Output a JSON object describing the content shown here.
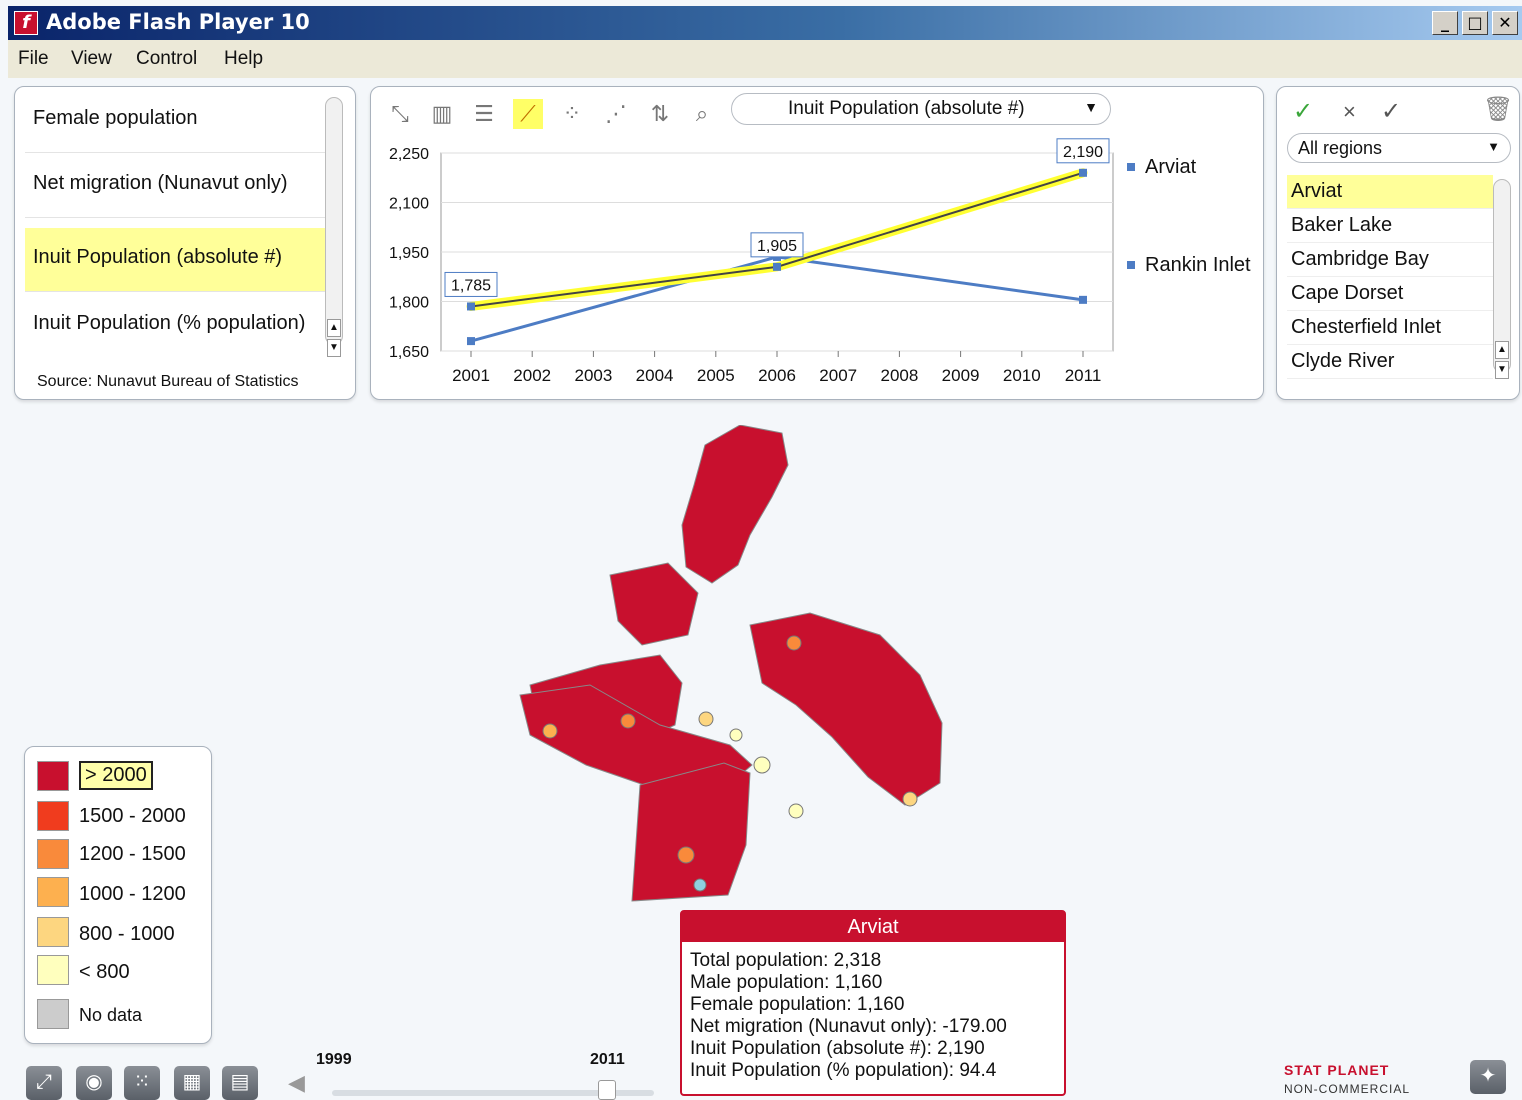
{
  "window": {
    "title": "Adobe Flash Player 10"
  },
  "menu": [
    "File",
    "View",
    "Control",
    "Help"
  ],
  "indicators": {
    "items": [
      "Female population",
      "Net migration (Nunavut only)",
      "Inuit Population (absolute #)",
      "Inuit Population (% population)"
    ],
    "selected_index": 2,
    "source": "Source: Nunavut Bureau of Statistics"
  },
  "chart_panel": {
    "dropdown": "Inuit Population (absolute #)"
  },
  "chart_data": {
    "type": "line",
    "x": [
      2001,
      2002,
      2003,
      2004,
      2005,
      2006,
      2007,
      2008,
      2009,
      2010,
      2011
    ],
    "ylim": [
      1650,
      2250
    ],
    "yticks": [
      2250,
      2100,
      1950,
      1800,
      1650
    ],
    "ytick_labels": [
      "2,250",
      "2,100",
      "1,950",
      "1,800",
      "1,650"
    ],
    "grid": true,
    "legend_position": "right",
    "series": [
      {
        "name": "Arviat",
        "color": "#4d7cc4",
        "highlight": "#ffff33",
        "points": [
          [
            2001,
            1785
          ],
          [
            2006,
            1905
          ],
          [
            2011,
            2190
          ]
        ],
        "labels": [
          "1,785",
          "1,905",
          "2,190"
        ]
      },
      {
        "name": "Rankin Inlet",
        "color": "#4d7cc4",
        "points": [
          [
            2001,
            1680
          ],
          [
            2006,
            1935
          ],
          [
            2011,
            1805
          ]
        ]
      }
    ]
  },
  "regions": {
    "dropdown": "All regions",
    "items": [
      "Arviat",
      "Baker Lake",
      "Cambridge Bay",
      "Cape Dorset",
      "Chesterfield Inlet",
      "Clyde River"
    ],
    "selected_index": 0
  },
  "legend": [
    {
      "label": "> 2000",
      "color": "#c8102e",
      "selected": true
    },
    {
      "label": "1500 - 2000",
      "color": "#f03c1e"
    },
    {
      "label": "1200 - 1500",
      "color": "#f98a3b"
    },
    {
      "label": "1000 - 1200",
      "color": "#fdb04f"
    },
    {
      "label": "800 - 1000",
      "color": "#fdd680"
    },
    {
      "label": "< 800",
      "color": "#ffffbe"
    },
    {
      "label": "No data",
      "color": "#cccccc"
    }
  ],
  "map": {
    "fill": "#c8102e"
  },
  "tooltip": {
    "title": "Arviat",
    "lines": [
      "Total population: 2,318",
      "Male population: 1,160",
      "Female population: 1,160",
      "Net migration (Nunavut only): -179.00",
      "Inuit Population (absolute #): 2,190",
      "Inuit Population (% population): 94.4"
    ]
  },
  "timeline": {
    "start_label": "1999",
    "end_label": "2011"
  },
  "brand": {
    "line1": "STAT PLANET",
    "line2": "NON-COMMERCIAL"
  }
}
